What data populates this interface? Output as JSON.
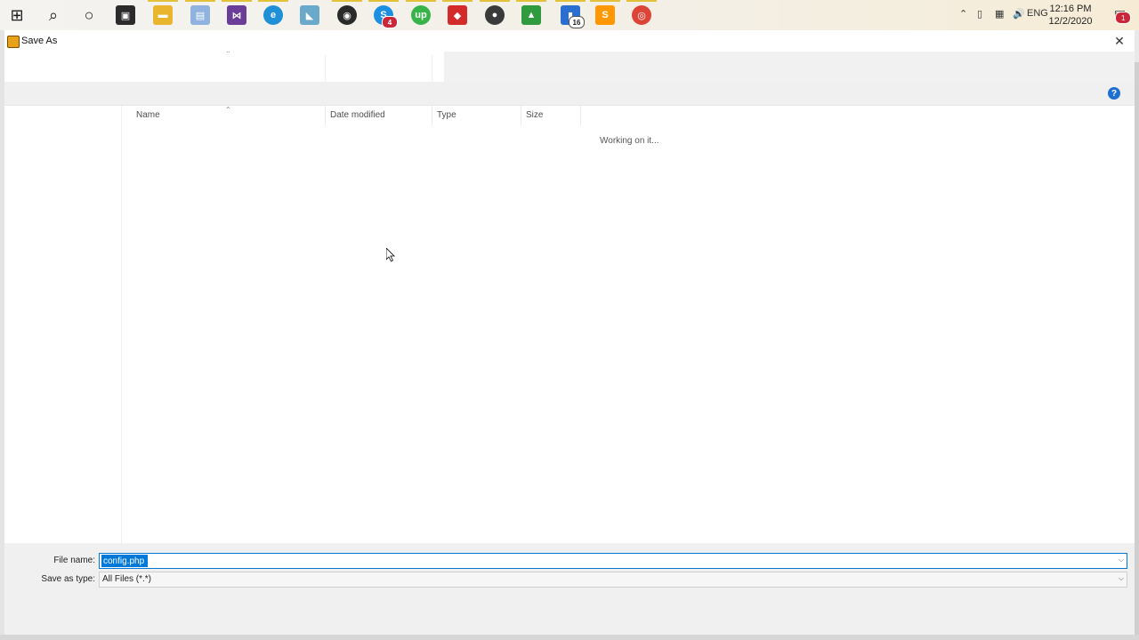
{
  "taskbar": {
    "icons": [
      {
        "name": "windows-start-icon",
        "color": "#1a1a1a"
      },
      {
        "name": "search-icon",
        "color": "#1a1a1a"
      },
      {
        "name": "cortana-icon",
        "color": "#1a1a1a"
      },
      {
        "name": "store-icon",
        "color": "#2b2b2b"
      },
      {
        "name": "file-explorer-icon",
        "color": "#e8b52c"
      },
      {
        "name": "files-app-icon",
        "color": "#8fb3de"
      },
      {
        "name": "visual-studio-icon",
        "color": "#6a3e98"
      },
      {
        "name": "edge-icon",
        "color": "#1f8fd8"
      },
      {
        "name": "notepad-icon",
        "color": "#6aa9c9"
      },
      {
        "name": "obs-icon",
        "color": "#2a2a2a"
      },
      {
        "name": "skype-icon",
        "color": "#1c8fe0",
        "badge": "4"
      },
      {
        "name": "upwork-icon",
        "color": "#37b34a"
      },
      {
        "name": "anydesk-icon",
        "color": "#d32a2a"
      },
      {
        "name": "chrome-profile-icon",
        "color": "#3a3a3a"
      },
      {
        "name": "app-green-red-icon",
        "color": "#2f9b3e"
      },
      {
        "name": "word-files-icon",
        "color": "#2a6ed1",
        "badge": "16"
      },
      {
        "name": "sublime-text-icon",
        "color": "#ff9800"
      },
      {
        "name": "chrome-icon",
        "color": "#db4437"
      }
    ],
    "tray": {
      "language": "ENG",
      "time": "12:16 PM",
      "date": "12/2/2020",
      "notification_badge": "1"
    }
  },
  "window": {
    "title": "Save As",
    "columns": [
      {
        "label": "Name"
      },
      {
        "label": "Date modified"
      },
      {
        "label": "Type"
      },
      {
        "label": "Size"
      }
    ],
    "status": "Working on it...",
    "form": {
      "file_name_label": "File name:",
      "file_name_value": "config.php",
      "save_type_label": "Save as type:",
      "save_type_value": "All Files (*.*)"
    }
  }
}
